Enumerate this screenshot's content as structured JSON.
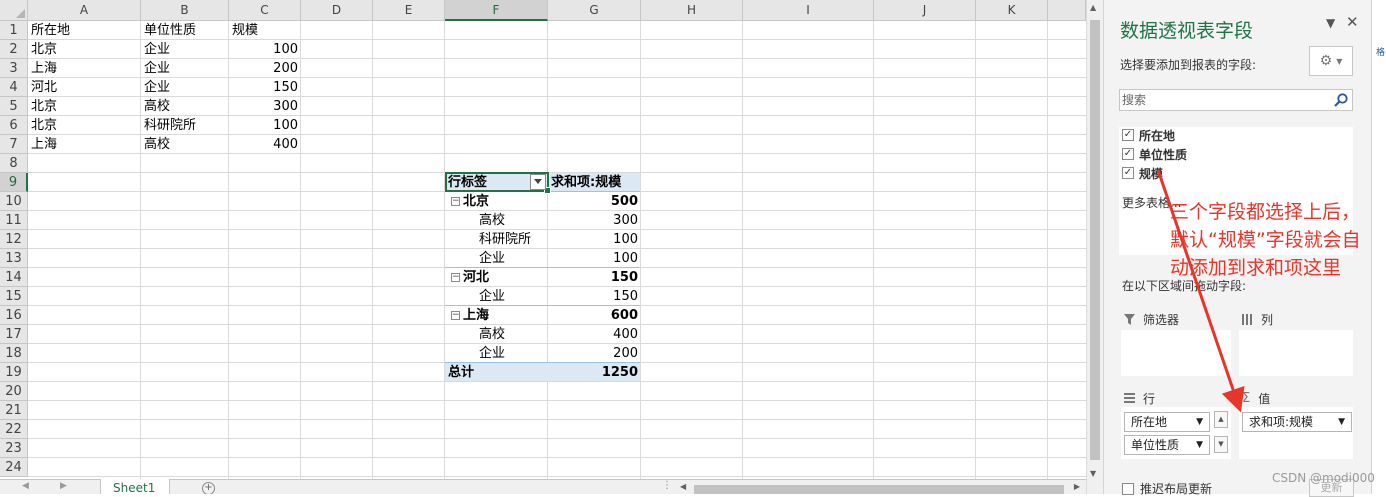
{
  "sheet": {
    "columns": [
      "A",
      "B",
      "C",
      "D",
      "E",
      "F",
      "G",
      "H",
      "I",
      "J",
      "K"
    ],
    "rows": [
      "1",
      "2",
      "3",
      "4",
      "5",
      "6",
      "7",
      "8",
      "9",
      "10",
      "11",
      "12",
      "13",
      "14",
      "15",
      "16",
      "17",
      "18",
      "19",
      "20",
      "21",
      "22",
      "23",
      "24"
    ],
    "source_header": [
      "所在地",
      "单位性质",
      "规模"
    ],
    "source_rows": [
      [
        "北京",
        "企业",
        "100"
      ],
      [
        "上海",
        "企业",
        "200"
      ],
      [
        "河北",
        "企业",
        "150"
      ],
      [
        "北京",
        "高校",
        "300"
      ],
      [
        "北京",
        "科研院所",
        "100"
      ],
      [
        "上海",
        "高校",
        "400"
      ]
    ],
    "selected_column": "F",
    "selected_row": "9"
  },
  "pivot": {
    "row_label_header": "行标签",
    "value_header": "求和项:规模",
    "rows": [
      {
        "label": "北京",
        "value": "500",
        "level": 0
      },
      {
        "label": "高校",
        "value": "300",
        "level": 1
      },
      {
        "label": "科研院所",
        "value": "100",
        "level": 1
      },
      {
        "label": "企业",
        "value": "100",
        "level": 1
      },
      {
        "label": "河北",
        "value": "150",
        "level": 0
      },
      {
        "label": "企业",
        "value": "150",
        "level": 1
      },
      {
        "label": "上海",
        "value": "600",
        "level": 0
      },
      {
        "label": "高校",
        "value": "400",
        "level": 1
      },
      {
        "label": "企业",
        "value": "200",
        "level": 1
      }
    ],
    "total_label": "总计",
    "total_value": "1250",
    "collapse_symbol": "⊟"
  },
  "tabs": {
    "sheet_tab": "Sheet1",
    "add_symbol": "+"
  },
  "pane": {
    "title": "数据透视表字段",
    "subtitle": "选择要添加到报表的字段:",
    "search_placeholder": "搜索",
    "fields": [
      {
        "name": "所在地",
        "checked": true
      },
      {
        "name": "单位性质",
        "checked": true
      },
      {
        "name": "规模",
        "checked": true
      }
    ],
    "more_tables": "更多表格...",
    "drag_hint": "在以下区域间拖动字段:",
    "areas": {
      "filters": "筛选器",
      "columns": "列",
      "rows": "行",
      "values": "值"
    },
    "row_fields": [
      "所在地",
      "单位性质"
    ],
    "value_fields": [
      "求和项:规模"
    ],
    "defer_label": "推迟布局更新",
    "update_label": "更新"
  },
  "edge_text": "格",
  "annotation": {
    "text": "三个字段都选择上后，默认“规模”字段就会自动添加到求和项这里",
    "color": "#e8352a"
  },
  "watermark": "CSDN @modi000"
}
